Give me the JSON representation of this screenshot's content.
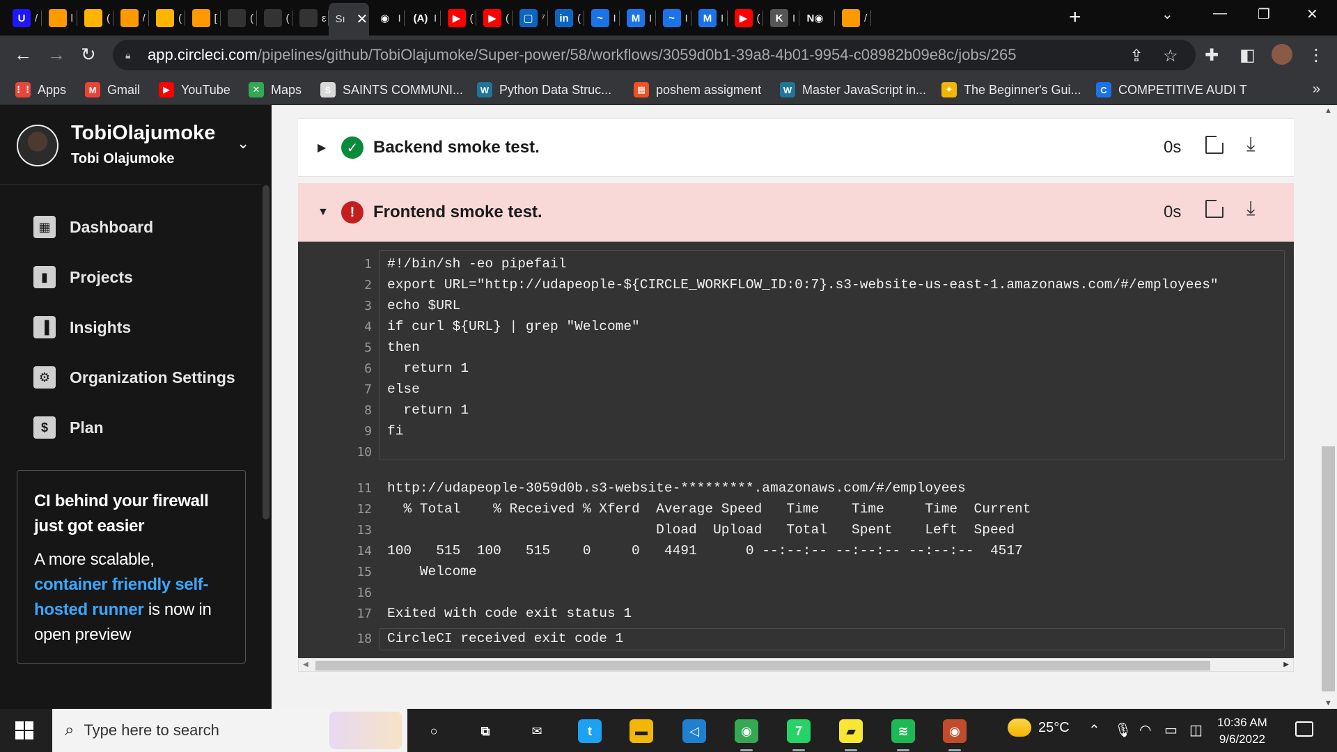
{
  "browser": {
    "tabs": [
      {
        "icon": "udacity-icon",
        "glyph": "U",
        "color": "#2015ff",
        "title": "/"
      },
      {
        "icon": "aws-icon",
        "glyph": "",
        "color": "#ff9900",
        "title": "l"
      },
      {
        "icon": "aws-icon",
        "glyph": "",
        "color": "#ffb400",
        "title": "("
      },
      {
        "icon": "aws-icon",
        "glyph": "",
        "color": "#ff9900",
        "title": "/"
      },
      {
        "icon": "aws-icon",
        "glyph": "",
        "color": "#ffb400",
        "title": "("
      },
      {
        "icon": "aws-icon",
        "glyph": "",
        "color": "#ff9900",
        "title": "["
      },
      {
        "icon": "github-icon",
        "glyph": "",
        "color": "#333333",
        "title": "("
      },
      {
        "icon": "github-icon",
        "glyph": "",
        "color": "#333333",
        "title": "("
      },
      {
        "icon": "github-icon",
        "glyph": "",
        "color": "#333333",
        "title": "ε"
      },
      {
        "icon": "circleci-icon",
        "glyph": "",
        "color": "#555555",
        "title": "Sı"
      },
      {
        "icon": "circleci-icon",
        "glyph": "◉",
        "color": "#0d0d0d",
        "title": "I"
      },
      {
        "icon": "app-icon",
        "glyph": "(A)",
        "color": "#0d0d0d",
        "title": "I"
      },
      {
        "icon": "youtube-icon",
        "glyph": "▶",
        "color": "#ff0000",
        "title": "("
      },
      {
        "icon": "youtube-icon",
        "glyph": "▶",
        "color": "#ff0000",
        "title": "("
      },
      {
        "icon": "linkedin-learning-icon",
        "glyph": "▢",
        "color": "#0a66c2",
        "title": "⁷"
      },
      {
        "icon": "linkedin-icon",
        "glyph": "in",
        "color": "#0a66c2",
        "title": "("
      },
      {
        "icon": "mail-icon",
        "glyph": "~",
        "color": "#1a73e8",
        "title": "I"
      },
      {
        "icon": "gmail-icon",
        "glyph": "M",
        "color": "#1a73e8",
        "title": "I"
      },
      {
        "icon": "mail-icon",
        "glyph": "~",
        "color": "#1a73e8",
        "title": "I"
      },
      {
        "icon": "gmail-icon",
        "glyph": "M",
        "color": "#1a73e8",
        "title": "I"
      },
      {
        "icon": "youtube-icon",
        "glyph": "▶",
        "color": "#ff0000",
        "title": "("
      },
      {
        "icon": "kaggle-icon",
        "glyph": "K",
        "color": "#555555",
        "title": "I"
      },
      {
        "icon": "record-icon",
        "glyph": "N◉",
        "color": "#0d0d0d",
        "title": ""
      },
      {
        "icon": "aws-icon",
        "glyph": "",
        "color": "#ff9900",
        "title": "/"
      }
    ],
    "active_tab_index": 9,
    "url_host": "app.circleci.com",
    "url_path": "/pipelines/github/TobiOlajumoke/Super-power/58/workflows/3059d0b1-39a8-4b01-9954-c08982b09e8c/jobs/265",
    "bookmarks": [
      {
        "label": "Apps",
        "icon": "apps-grid-icon",
        "color": "#e8453c",
        "glyph": "⋮⋮"
      },
      {
        "label": "Gmail",
        "icon": "gmail-icon",
        "color": "#ea4335",
        "glyph": "M"
      },
      {
        "label": "YouTube",
        "icon": "youtube-icon",
        "color": "#ff0000",
        "glyph": "▶"
      },
      {
        "label": "Maps",
        "icon": "maps-icon",
        "color": "#34a853",
        "glyph": "✕"
      },
      {
        "label": "SAINTS COMMUNI...",
        "icon": "bookmark-site-icon",
        "color": "#d9d9d9",
        "glyph": "S"
      },
      {
        "label": "Python  Data Struc...",
        "icon": "wordpress-icon",
        "color": "#21759b",
        "glyph": "W"
      },
      {
        "label": "poshem assigment",
        "icon": "microsoft-icon",
        "color": "#f25022",
        "glyph": "▦"
      },
      {
        "label": "Master JavaScript in...",
        "icon": "wordpress-icon",
        "color": "#21759b",
        "glyph": "W"
      },
      {
        "label": "The Beginner's Gui...",
        "icon": "handshake-icon",
        "color": "#f2b705",
        "glyph": "✦"
      },
      {
        "label": "COMPETITIVE AUDI T",
        "icon": "site-c-icon",
        "color": "#1a73e8",
        "glyph": "C"
      }
    ],
    "more_label": "»"
  },
  "sidebar": {
    "org_name": "TobiOlajumoke",
    "user_name": "Tobi Olajumoke",
    "nav": [
      {
        "label": "Dashboard",
        "icon": "dashboard-icon",
        "glyph": "▦"
      },
      {
        "label": "Projects",
        "icon": "projects-icon",
        "glyph": "▮"
      },
      {
        "label": "Insights",
        "icon": "insights-icon",
        "glyph": "▐"
      },
      {
        "label": "Organization Settings",
        "icon": "gear-icon",
        "glyph": "⚙"
      },
      {
        "label": "Plan",
        "icon": "plan-icon",
        "glyph": "$"
      }
    ],
    "promo": {
      "title": "CI behind your firewall just got easier",
      "body_pre": "A more scalable, ",
      "link": "container friendly self-hosted runner",
      "body_post": " is now in open preview"
    }
  },
  "steps": [
    {
      "name": "Backend smoke test.",
      "duration": "0s",
      "status": "success",
      "expanded": false
    },
    {
      "name": "Frontend smoke test.",
      "duration": "0s",
      "status": "failed",
      "expanded": true
    }
  ],
  "output": {
    "command_lines": [
      "#!/bin/sh -eo pipefail",
      "export URL=\"http://udapeople-${CIRCLE_WORKFLOW_ID:0:7}.s3-website-us-east-1.amazonaws.com/#/employees\"",
      "echo $URL",
      "if curl ${URL} | grep \"Welcome\"",
      "then",
      "  return 1",
      "else",
      "  return 1",
      "fi",
      ""
    ],
    "log_lines": [
      "http://udapeople-3059d0b.s3-website-*********.amazonaws.com/#/employees",
      "  % Total    % Received % Xferd  Average Speed   Time    Time     Time  Current",
      "                                 Dload  Upload   Total   Spent    Left  Speed",
      "100   515  100   515    0     0   4491      0 --:--:-- --:--:-- --:--:--  4517",
      "    Welcome",
      "",
      "Exited with code exit status 1"
    ],
    "final_line": "CircleCI received exit code 1"
  },
  "taskbar": {
    "search_placeholder": "Type here to search",
    "apps": [
      {
        "icon": "cortana-icon",
        "glyph": "○",
        "color": "#202020"
      },
      {
        "icon": "task-view-icon",
        "glyph": "⧉",
        "color": "#202020"
      },
      {
        "icon": "mail-icon",
        "glyph": "✉",
        "color": "#202020"
      },
      {
        "icon": "twitter-icon",
        "glyph": "t",
        "color": "#1da1f2"
      },
      {
        "icon": "file-explorer-icon",
        "glyph": "▬",
        "color": "#f2b705"
      },
      {
        "icon": "vscode-icon",
        "glyph": "◁",
        "color": "#1f7fd1"
      },
      {
        "icon": "chrome-icon",
        "glyph": "◉",
        "color": "#34a853"
      },
      {
        "icon": "whatsapp-icon",
        "glyph": "7",
        "color": "#25d366"
      },
      {
        "icon": "sticky-notes-icon",
        "glyph": "▰",
        "color": "#f7e733"
      },
      {
        "icon": "spotify-icon",
        "glyph": "≋",
        "color": "#1db954"
      },
      {
        "icon": "chrome-profile-icon",
        "glyph": "◉",
        "color": "#c14b2b"
      }
    ],
    "weather": "25°C",
    "time": "10:36 AM",
    "date": "9/6/2022"
  },
  "colors": {
    "success": "#0a8a3a",
    "failed": "#c41f1f",
    "failed_bg": "#f9d8d8",
    "link": "#3aa7ff"
  }
}
